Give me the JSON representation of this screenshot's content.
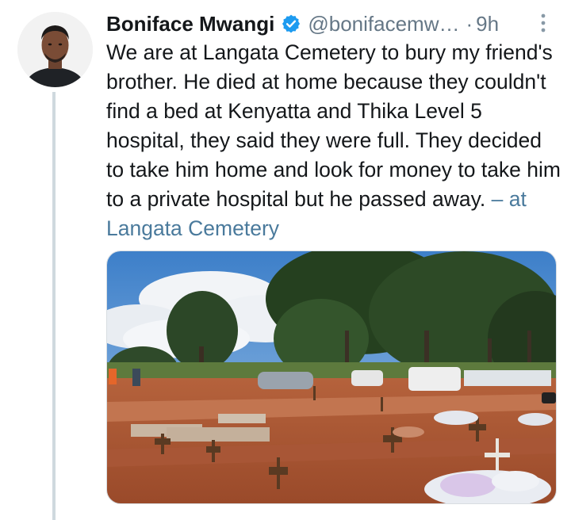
{
  "tweet": {
    "author_name": "Boniface Mwangi",
    "handle": "@bonifacemw…",
    "separator": "·",
    "time": "9h",
    "text": "We are at Langata Cemetery to bury my friend's brother. He died at home because they couldn't find a bed at Kenyatta and Thika Level 5 hospital, they said they were full. They decided to take him home and look for money to take him to a private hospital but he passed away. ",
    "location": "– at Langata Cemetery"
  },
  "icons": {
    "verified": "verified-badge-icon",
    "more": "more-options-icon"
  },
  "colors": {
    "verified_blue": "#1d9bf0",
    "secondary_text": "#657786",
    "location_link": "#4a7a9c",
    "thread_line": "#cfd9de"
  }
}
